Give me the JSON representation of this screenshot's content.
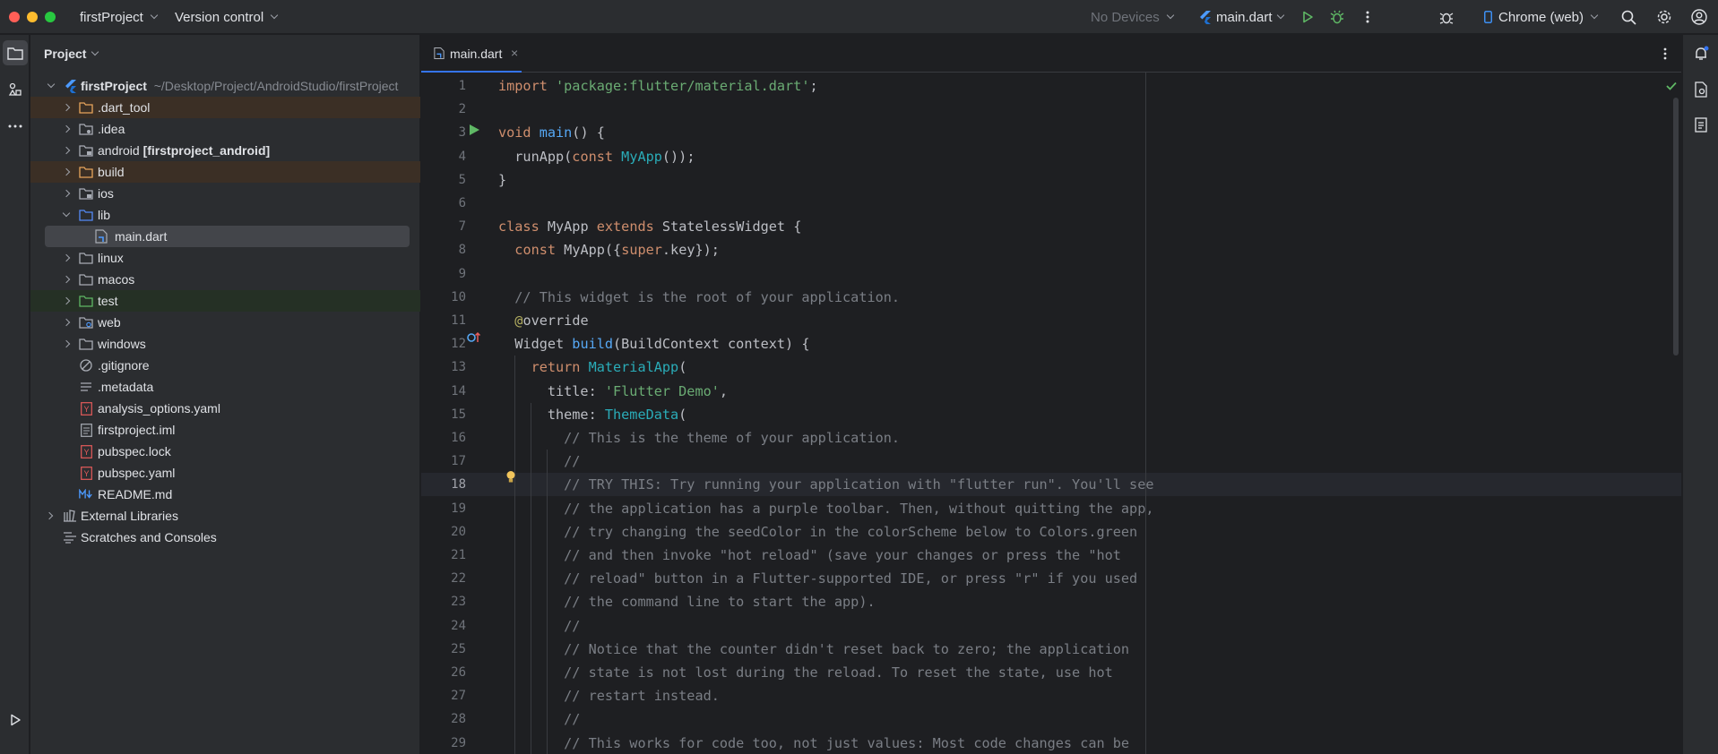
{
  "titlebar": {
    "project_name": "firstProject",
    "vcs_label": "Version control",
    "devices_label": "No Devices",
    "run_config": "main.dart",
    "target_device": "Chrome (web)"
  },
  "project_panel": {
    "header": "Project",
    "root": {
      "name": "firstProject",
      "path": "~/Desktop/Project/AndroidStudio/firstProject"
    },
    "items": [
      {
        "label": ".dart_tool"
      },
      {
        "label": ".idea"
      },
      {
        "label": "android",
        "module": "[firstproject_android]"
      },
      {
        "label": "build"
      },
      {
        "label": "ios"
      },
      {
        "label": "lib"
      },
      {
        "label": "main.dart"
      },
      {
        "label": "linux"
      },
      {
        "label": "macos"
      },
      {
        "label": "test"
      },
      {
        "label": "web"
      },
      {
        "label": "windows"
      },
      {
        "label": ".gitignore"
      },
      {
        "label": ".metadata"
      },
      {
        "label": "analysis_options.yaml"
      },
      {
        "label": "firstproject.iml"
      },
      {
        "label": "pubspec.lock"
      },
      {
        "label": "pubspec.yaml"
      },
      {
        "label": "README.md"
      },
      {
        "label": "External Libraries"
      },
      {
        "label": "Scratches and Consoles"
      }
    ]
  },
  "editor": {
    "tab_label": "main.dart",
    "current_line": 18,
    "line_numbers": [
      "1",
      "2",
      "3",
      "4",
      "5",
      "6",
      "7",
      "8",
      "9",
      "10",
      "11",
      "12",
      "13",
      "14",
      "15",
      "16",
      "17",
      "18",
      "19",
      "20",
      "21",
      "22",
      "23",
      "24",
      "25",
      "26",
      "27",
      "28",
      "29"
    ],
    "lines": [
      [
        {
          "t": "import ",
          "c": "kw"
        },
        {
          "t": "'package:flutter/material.dart'",
          "c": "str"
        },
        {
          "t": ";",
          "c": ""
        }
      ],
      [],
      [
        {
          "t": "void ",
          "c": "kw"
        },
        {
          "t": "main",
          "c": "fn"
        },
        {
          "t": "() {",
          "c": ""
        }
      ],
      [
        {
          "t": "  runApp(",
          "c": ""
        },
        {
          "t": "const ",
          "c": "kw"
        },
        {
          "t": "MyApp",
          "c": "cls"
        },
        {
          "t": "());",
          "c": ""
        }
      ],
      [
        {
          "t": "}",
          "c": ""
        }
      ],
      [],
      [
        {
          "t": "class ",
          "c": "kw"
        },
        {
          "t": "MyApp ",
          "c": ""
        },
        {
          "t": "extends ",
          "c": "kw"
        },
        {
          "t": "StatelessWidget {",
          "c": ""
        }
      ],
      [
        {
          "t": "  ",
          "c": ""
        },
        {
          "t": "const ",
          "c": "kw"
        },
        {
          "t": "MyApp({",
          "c": ""
        },
        {
          "t": "super",
          "c": "kw"
        },
        {
          "t": ".key});",
          "c": ""
        }
      ],
      [],
      [
        {
          "t": "  // This widget is the root of your application.",
          "c": "cm"
        }
      ],
      [
        {
          "t": "  ",
          "c": ""
        },
        {
          "t": "@",
          "c": "ann"
        },
        {
          "t": "override",
          "c": ""
        }
      ],
      [
        {
          "t": "  Widget ",
          "c": ""
        },
        {
          "t": "build",
          "c": "fn"
        },
        {
          "t": "(BuildContext context) {",
          "c": ""
        }
      ],
      [
        {
          "t": "    ",
          "c": ""
        },
        {
          "t": "return ",
          "c": "kw"
        },
        {
          "t": "MaterialApp",
          "c": "cls"
        },
        {
          "t": "(",
          "c": ""
        }
      ],
      [
        {
          "t": "      title: ",
          "c": ""
        },
        {
          "t": "'Flutter Demo'",
          "c": "str"
        },
        {
          "t": ",",
          "c": ""
        }
      ],
      [
        {
          "t": "      theme: ",
          "c": ""
        },
        {
          "t": "ThemeData",
          "c": "cls"
        },
        {
          "t": "(",
          "c": ""
        }
      ],
      [
        {
          "t": "        // This is the theme of your application.",
          "c": "cm"
        }
      ],
      [
        {
          "t": "        //",
          "c": "cm"
        }
      ],
      [
        {
          "t": "        // TRY THIS: Try running your application with \"flutter run\". You'll see",
          "c": "cm"
        }
      ],
      [
        {
          "t": "        // the application has a purple toolbar. Then, without quitting the app,",
          "c": "cm"
        }
      ],
      [
        {
          "t": "        // try changing the seedColor in the colorScheme below to Colors.green",
          "c": "cm"
        }
      ],
      [
        {
          "t": "        // and then invoke \"hot reload\" (save your changes or press the \"hot",
          "c": "cm"
        }
      ],
      [
        {
          "t": "        // reload\" button in a Flutter-supported IDE, or press \"r\" if you used",
          "c": "cm"
        }
      ],
      [
        {
          "t": "        // the command line to start the app).",
          "c": "cm"
        }
      ],
      [
        {
          "t": "        //",
          "c": "cm"
        }
      ],
      [
        {
          "t": "        // Notice that the counter didn't reset back to zero; the application",
          "c": "cm"
        }
      ],
      [
        {
          "t": "        // state is not lost during the reload. To reset the state, use hot",
          "c": "cm"
        }
      ],
      [
        {
          "t": "        // restart instead.",
          "c": "cm"
        }
      ],
      [
        {
          "t": "        //",
          "c": "cm"
        }
      ],
      [
        {
          "t": "        // This works for code too, not just values: Most code changes can be",
          "c": "cm"
        }
      ]
    ]
  },
  "colors": {
    "accent": "#3574f0",
    "run_green": "#5fb865",
    "folder_excluded": "#e8a55c",
    "flutter_blue": "#4c9aff"
  }
}
